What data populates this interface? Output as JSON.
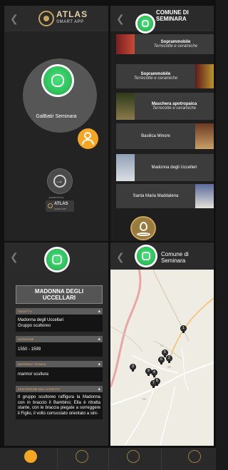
{
  "screen1": {
    "logo_text": "ATLAS",
    "logo_sub": "SMART APP",
    "user_name": "GalBatir Seminara",
    "powered_by": "powered by",
    "mini_logo_text": "ATLAS",
    "mini_logo_sub": "SMART APP"
  },
  "screen2": {
    "title_line1": "COMUNE DI",
    "title_line2": "SEMINARA",
    "items": [
      {
        "title": "Soprammobile",
        "subtitle": "Terrecotte e ceramiche"
      },
      {
        "title": "Soprammobile",
        "subtitle": "Terrecotte e ceramiche"
      },
      {
        "title": "Maschera apotropaica",
        "subtitle": "Terrecotte e ceramiche"
      },
      {
        "title": "Basilica Minore"
      },
      {
        "title": "Madonna degli Uccelleri"
      },
      {
        "title": "Santa Maria Maddalena"
      }
    ]
  },
  "screen3": {
    "title": "MADONNA DEGLI UCCELLARI",
    "sections": [
      {
        "label": "OGGETTO",
        "lines": [
          "Madonna degli Uccellari",
          "Gruppo scultoreo"
        ]
      },
      {
        "label": "DATAZIONE",
        "lines": [
          "1550 - 1599"
        ]
      },
      {
        "label": "MATERIA E TECNICA",
        "lines": [
          "marmo/ scultura"
        ]
      },
      {
        "label": "DESCRIZIONE DELL'OGGETTO",
        "lines": [
          "Il gruppo scultoreo raffigura la Madonna con in braccio il Bambino; Ella è ritratta stante, con le braccia piegate a sorreggere il Figlio, il volto corrucciato orientato a sini-"
        ]
      }
    ]
  },
  "screen4": {
    "title_line1": "Comune di",
    "title_line2": "Seminara",
    "pins": [
      "1",
      "5",
      "2",
      "6",
      "3",
      "9",
      "4",
      "8",
      "7"
    ]
  },
  "colors": {
    "accent_orange": "#f5a623",
    "accent_green": "#2fc45c",
    "gold": "#c9a45a",
    "section_label": "#f0b06a"
  },
  "icons": [
    "back-chevron-icon",
    "atlas-logo-icon",
    "app-logo-icon",
    "location-person-icon",
    "login-arrow-icon",
    "map-pin-icon",
    "home-icon",
    "map-icon",
    "shop-icon",
    "ar-icon"
  ]
}
